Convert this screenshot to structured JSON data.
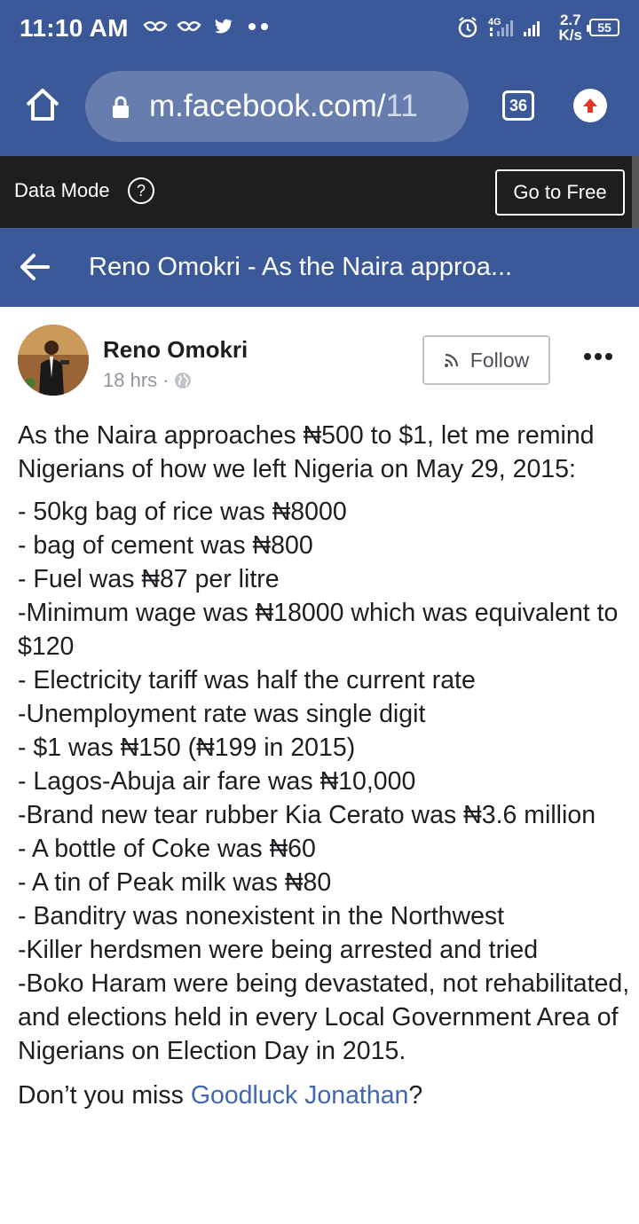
{
  "status_bar": {
    "time": "11:10 AM",
    "net_type": "4G",
    "net_speed_value": "2.7",
    "net_speed_unit": "K/s",
    "battery": "55",
    "notification_icons": [
      "glo-icon",
      "glo-icon",
      "twitter-icon",
      "more-dots-icon"
    ]
  },
  "browser": {
    "url_main": "m.facebook.com/",
    "url_tail": "11",
    "tab_count": "36"
  },
  "data_mode": {
    "label": "Data Mode",
    "help": "?",
    "button": "Go to Free"
  },
  "header": {
    "title": "Reno Omokri - As the Naira approa..."
  },
  "post": {
    "author": "Reno Omokri",
    "time": "18 hrs",
    "separator": "·",
    "follow_label": "Follow",
    "intro": "As the Naira approaches ₦500 to $1, let me remind Nigerians of how we left Nigeria on May 29, 2015:",
    "items": [
      "- 50kg bag of rice was ₦8000",
      "- bag of cement was ₦800",
      "- Fuel was ₦87 per litre",
      "-Minimum wage was ₦18000 which was equivalent to $120",
      "- Electricity tariff was half the current rate",
      "-Unemployment rate was single digit",
      "- $1 was ₦150 (₦199 in 2015)",
      "- Lagos-Abuja air fare was ₦10,000",
      "-Brand new tear rubber Kia Cerato was ₦3.6 million",
      "- A bottle of Coke was ₦60",
      "- A tin of Peak milk was ₦80",
      "- Banditry was nonexistent in the Northwest",
      "-Killer herdsmen were being arrested and tried",
      "-Boko Haram were being devastated, not rehabilitated, and elections held in every Local Government Area of Nigerians on Election Day in 2015."
    ],
    "closing_before": "Don’t you miss ",
    "closing_link": "Goodluck Jonathan",
    "closing_after": "?"
  },
  "colors": {
    "brand_blue": "#3b5998",
    "data_bar": "#1d1e20",
    "link": "#4267b2"
  }
}
